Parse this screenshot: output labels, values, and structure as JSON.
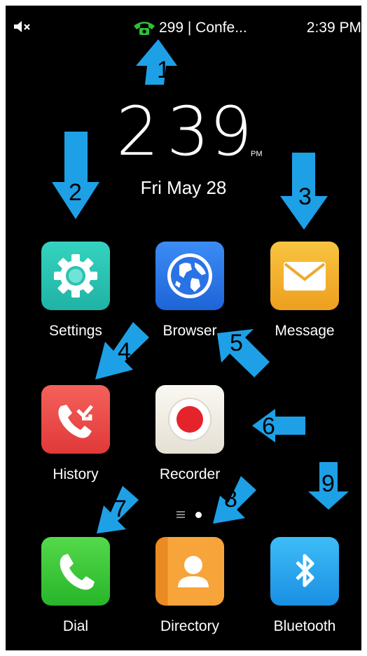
{
  "status_bar": {
    "call_text": "299 | Confe...",
    "time": "2:39 PM",
    "icons": [
      "mute-icon",
      "phone-call-icon"
    ]
  },
  "clock": {
    "hour": "2",
    "minutes": "39",
    "ampm": "PM",
    "date": "Fri May 28"
  },
  "apps": [
    {
      "label": "Settings",
      "icon": "gear-icon",
      "color": "#2ec7b5"
    },
    {
      "label": "Browser",
      "icon": "globe-icon",
      "color": "#2a7df0"
    },
    {
      "label": "Message",
      "icon": "envelope-icon",
      "color": "#f3b12e"
    },
    {
      "label": "History",
      "icon": "missed-call-icon",
      "color": "#ef4b48"
    },
    {
      "label": "Recorder",
      "icon": "record-icon",
      "color": "#efece3"
    },
    {
      "label": "Dial",
      "icon": "phone-icon",
      "color": "#3ec93a"
    },
    {
      "label": "Directory",
      "icon": "contact-icon",
      "color": "#f39b2e"
    },
    {
      "label": "Bluetooth",
      "icon": "bluetooth-icon",
      "color": "#27a5ee"
    }
  ],
  "page_indicator": {
    "pages": 2,
    "current": 2
  },
  "annotations": {
    "color": "#1ea0e6",
    "numbers": [
      "1",
      "2",
      "3",
      "4",
      "5",
      "6",
      "7",
      "8",
      "9"
    ]
  }
}
